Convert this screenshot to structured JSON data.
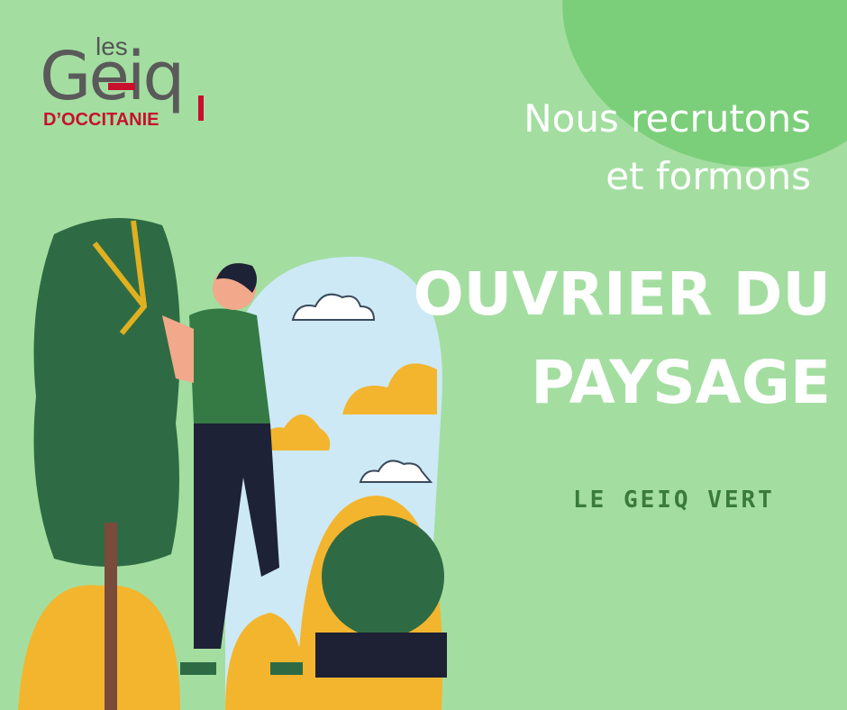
{
  "logo": {
    "les": "les",
    "brand": "Geiq",
    "region": "D’OCCITANIE"
  },
  "headline": {
    "line1": "Nous recrutons",
    "line2": "et formons"
  },
  "job": {
    "line1": "OUVRIER DU",
    "line2": "PAYSAGE"
  },
  "tag": "LE GEIQ VERT",
  "colors": {
    "background": "#a3dea0",
    "accent_green": "#7ccf7a",
    "brand_red": "#c8102e",
    "tag_green": "#3a7a3a"
  }
}
